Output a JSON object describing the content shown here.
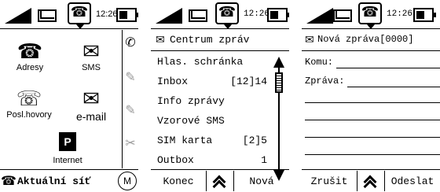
{
  "screen1": {
    "time": "12:26",
    "apps": [
      {
        "label": "Adresy",
        "icon": "address-book-icon"
      },
      {
        "label": "SMS",
        "icon": "sms-icon"
      },
      {
        "label": "Posl.hovory",
        "icon": "recent-calls-icon"
      },
      {
        "label": "e-mail",
        "icon": "email-icon"
      },
      {
        "label": "Internet",
        "icon": "internet-icon"
      }
    ],
    "footer_label": "Aktuální síť"
  },
  "screen2": {
    "time": "12:26",
    "title": "Centrum zpráv",
    "items": [
      {
        "label": "Hlas. schránka",
        "count": ""
      },
      {
        "label": "Inbox",
        "count": "[12]14"
      },
      {
        "label": "Info zprávy",
        "count": ""
      },
      {
        "label": "Vzorové SMS",
        "count": ""
      },
      {
        "label": "SIM karta",
        "count": "[2]5"
      },
      {
        "label": "Outbox",
        "count": "1"
      }
    ],
    "left_soft": "Konec",
    "right_soft": "Nová"
  },
  "screen3": {
    "time": "12:26",
    "title": "Nová zpráva[0000]",
    "to_label": "Komu:",
    "msg_label": "Zpráva:",
    "left_soft": "Zrušit",
    "right_soft": "Odeslat"
  }
}
